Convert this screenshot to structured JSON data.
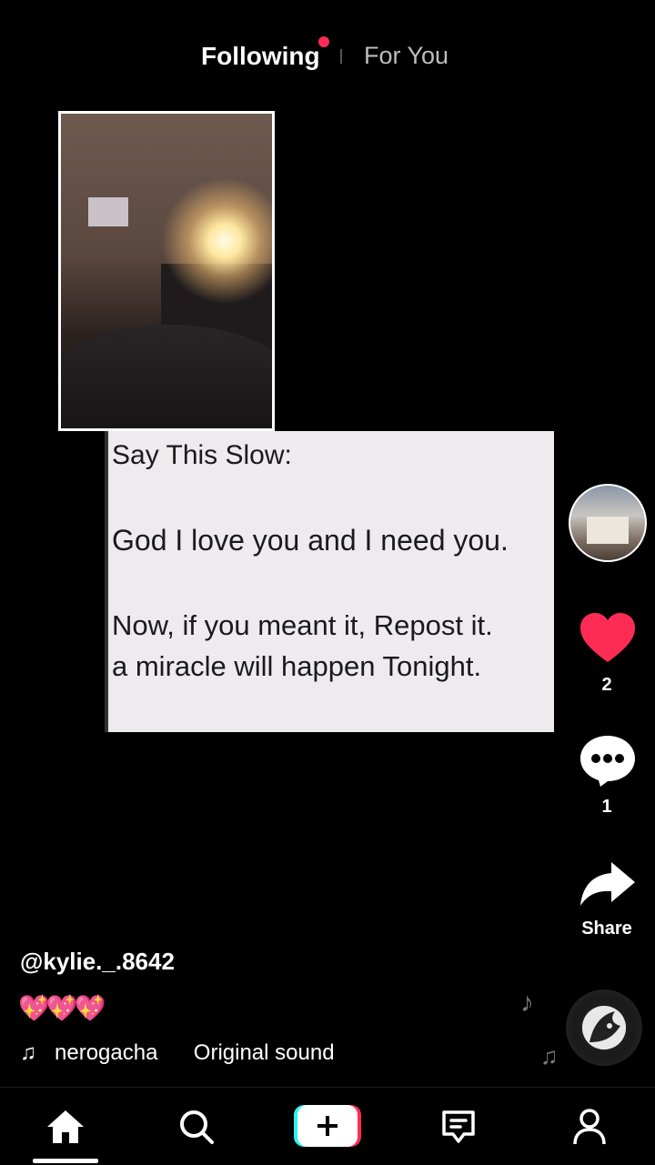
{
  "header": {
    "tab_following": "Following",
    "tab_for_you": "For You"
  },
  "video": {
    "card_lines": [
      "Say This Slow:",
      "God I love you and I need you.",
      "Now, if you meant it, Repost it.",
      "a miracle will happen Tonight."
    ]
  },
  "actions": {
    "like_count": "2",
    "comment_count": "1",
    "share_label": "Share"
  },
  "post": {
    "username": "@kylie._.8642",
    "caption": "💖💖💖",
    "sound_author": "nerogacha",
    "sound_title": "Original sound"
  },
  "nav": {
    "items": [
      "home-icon",
      "search-icon",
      "create-icon",
      "inbox-icon",
      "profile-icon"
    ]
  },
  "colors": {
    "accent": "#fe2c55",
    "background": "#000000",
    "create_cyan": "#25f4ee"
  }
}
